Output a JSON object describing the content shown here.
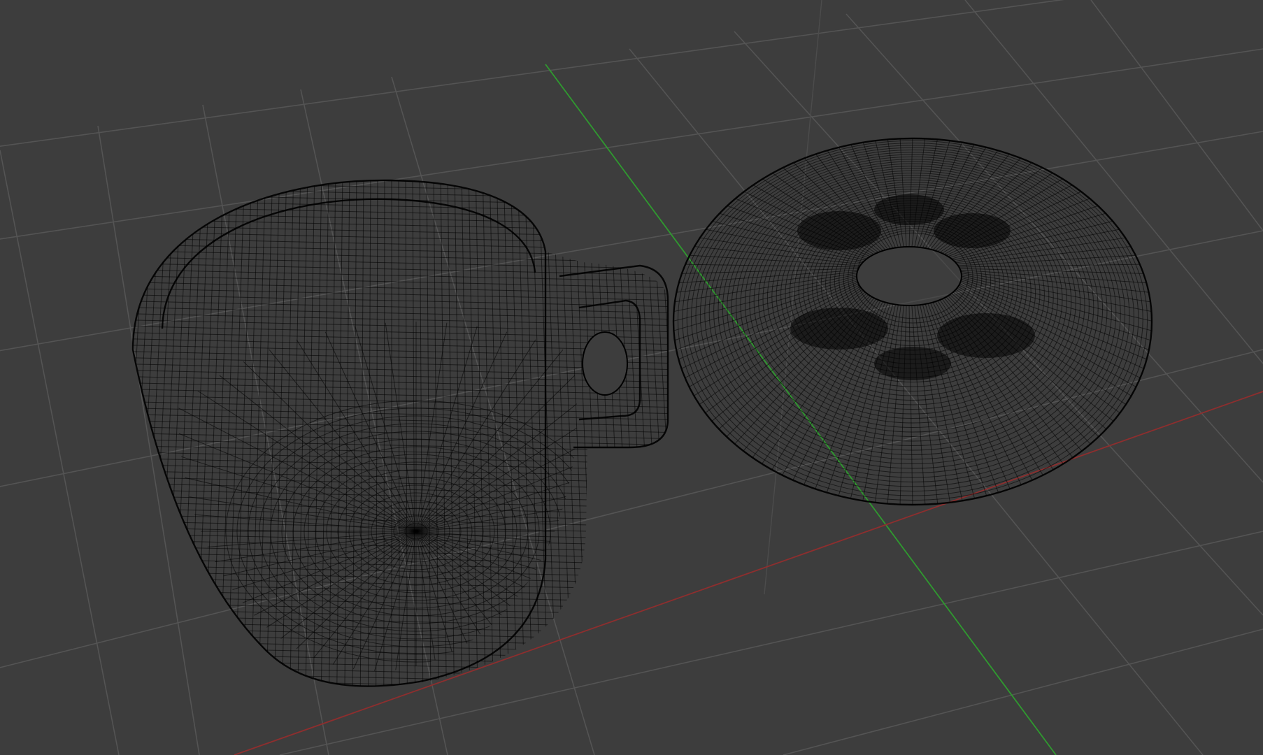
{
  "viewport": {
    "mode": "wireframe",
    "background_color": "#3d3d3d",
    "grid_color": "#545454",
    "wire_color": "#000000",
    "axes": {
      "x_color": "#8e2e2e",
      "y_color": "#2f9a2f"
    }
  },
  "scene": {
    "objects": [
      {
        "name": "mug",
        "shape": "cylinder-with-handle"
      },
      {
        "name": "donut",
        "shape": "torus"
      }
    ]
  }
}
